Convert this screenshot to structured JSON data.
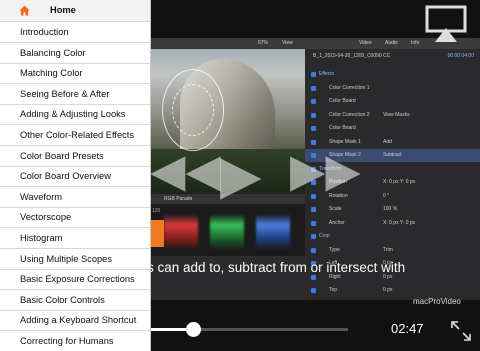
{
  "menu": {
    "home_label": "Home",
    "items": [
      {
        "label": "Introduction"
      },
      {
        "label": "Balancing Color"
      },
      {
        "label": "Matching Color"
      },
      {
        "label": "Seeing Before & After"
      },
      {
        "label": "Adding & Adjusting Looks"
      },
      {
        "label": "Other Color-Related Effects"
      },
      {
        "label": "Color Board Presets"
      },
      {
        "label": "Color Board Overview"
      },
      {
        "label": "Waveform"
      },
      {
        "label": "Vectorscope"
      },
      {
        "label": "Histogram"
      },
      {
        "label": "Using Multiple Scopes"
      },
      {
        "label": "Basic Exposure Corrections"
      },
      {
        "label": "Basic Color Controls"
      },
      {
        "label": "Adding a Keyboard Shortcut"
      },
      {
        "label": "Correcting for Humans"
      }
    ],
    "home_icon": "home-icon",
    "accent_color": "#f26a21"
  },
  "video": {
    "caption": "s can add to, subtract from or intersect with",
    "time": "02:47",
    "progress_fraction": 0.22,
    "brand": "macProVideo",
    "app": {
      "zoom": "57%",
      "view_label": "View",
      "scope_title": "RGB Parade",
      "scope_scale": "120",
      "inspector_tabs": [
        "Video",
        "Audio",
        "Info"
      ],
      "clip_name": "B_1_2015-04-20_1309_C0090 CC",
      "clip_time": "00:00:04:00",
      "rows": [
        {
          "label": "Effects",
          "type": "hd"
        },
        {
          "label": "Color Correction 1",
          "type": "row"
        },
        {
          "label": "Color Board",
          "type": "row"
        },
        {
          "label": "Color Correction 2",
          "type": "row",
          "extra": "View Masks"
        },
        {
          "label": "Color Board",
          "type": "row"
        },
        {
          "label": "Shape Mask 1",
          "type": "row",
          "extra": "Add"
        },
        {
          "label": "Shape Mask 2",
          "type": "sel",
          "extra": "Subtract"
        },
        {
          "label": "Transform",
          "type": "hd"
        },
        {
          "label": "Position",
          "type": "row",
          "extra": "X: 0 px   Y: 0 px"
        },
        {
          "label": "Rotation",
          "type": "row",
          "extra": "0 °"
        },
        {
          "label": "Scale",
          "type": "row",
          "extra": "100 %"
        },
        {
          "label": "Anchor",
          "type": "row",
          "extra": "X: 0 px   Y: 0 px"
        },
        {
          "label": "Crop",
          "type": "hd"
        },
        {
          "label": "Type",
          "type": "row",
          "extra": "Trim"
        },
        {
          "label": "Left",
          "type": "row",
          "extra": "0 px"
        },
        {
          "label": "Right",
          "type": "row",
          "extra": "0 px"
        },
        {
          "label": "Top",
          "type": "row",
          "extra": "0 px"
        }
      ]
    }
  }
}
